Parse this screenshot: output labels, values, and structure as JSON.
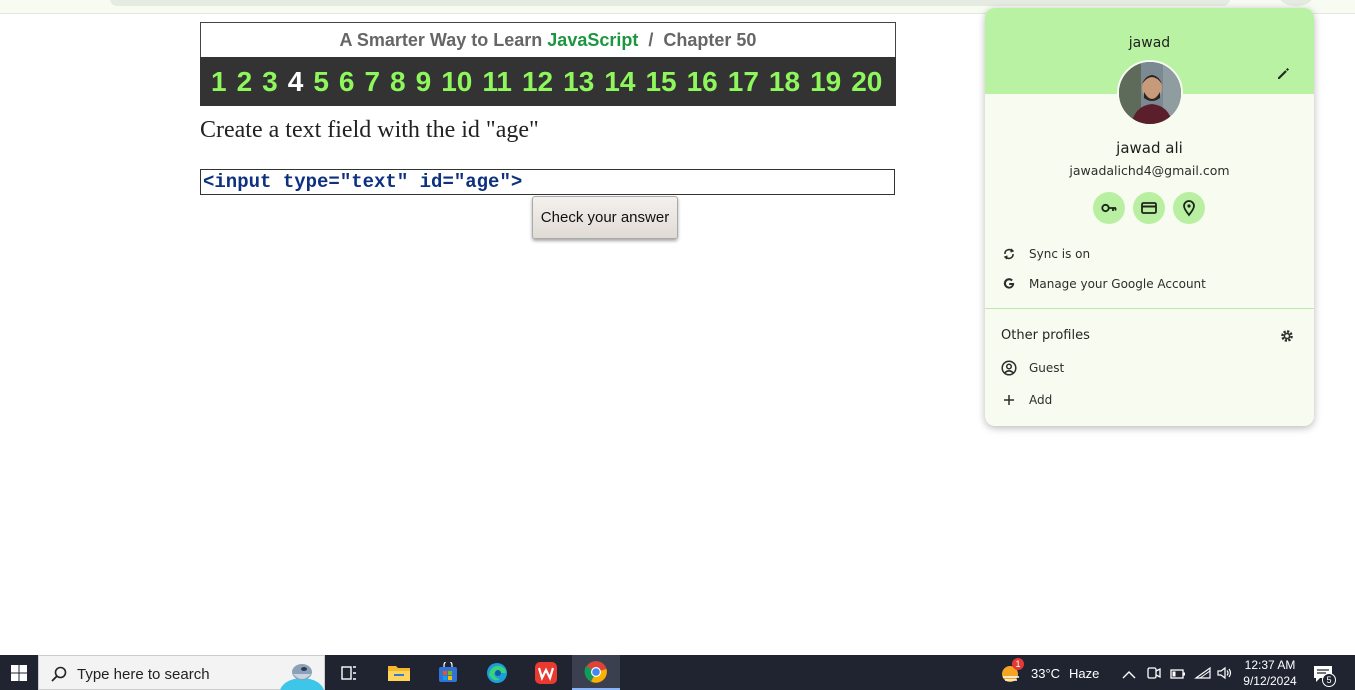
{
  "course": {
    "title_prefix": "A Smarter Way to Learn",
    "title_brand": "JavaScript",
    "title_sep": "/",
    "chapter_label": "Chapter 50",
    "chapters": [
      "1",
      "2",
      "3",
      "4",
      "5",
      "6",
      "7",
      "8",
      "9",
      "10",
      "11",
      "12",
      "13",
      "14",
      "15",
      "16",
      "17",
      "18",
      "19",
      "20"
    ],
    "current_chapter": "4",
    "prompt": "Create a text field with the id \"age\"",
    "answer_value": "<input type=\"text\" id=\"age\">",
    "check_button": "Check your answer"
  },
  "profile": {
    "banner_name": "jawad",
    "full_name": "jawad ali",
    "email": "jawadalichd4@gmail.com",
    "quick_icons": [
      "key-icon",
      "credit-card-icon",
      "location-pin-icon"
    ],
    "sync_label": "Sync is on",
    "manage_label": "Manage your Google Account",
    "other_profiles_title": "Other profiles",
    "guest_label": "Guest",
    "add_label": "Add"
  },
  "taskbar": {
    "search_placeholder": "Type here to search",
    "apps": [
      "task-view-icon",
      "file-explorer-icon",
      "microsoft-store-icon",
      "edge-icon",
      "wps-office-icon",
      "chrome-icon"
    ],
    "weather_temp": "33°C",
    "weather_desc": "Haze",
    "weather_badge": "1",
    "time": "12:37 AM",
    "date": "9/12/2024",
    "notification_count": "5"
  },
  "colors": {
    "brand_green": "#1e9641",
    "chapter_green": "#8ef75c",
    "nav_bg": "#333333",
    "profile_banner": "#b9f2a2",
    "code_blue": "#0d3180"
  }
}
